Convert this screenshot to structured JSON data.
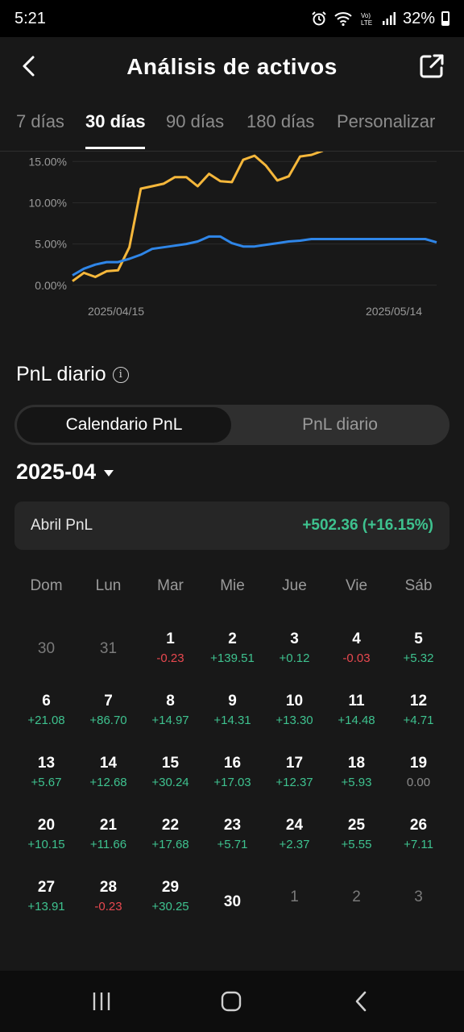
{
  "status_bar": {
    "time": "5:21",
    "battery": "32%"
  },
  "header": {
    "title": "Análisis de activos"
  },
  "tabs": [
    {
      "label": "7 días",
      "active": false
    },
    {
      "label": "30 días",
      "active": true
    },
    {
      "label": "90 días",
      "active": false
    },
    {
      "label": "180 días",
      "active": false
    },
    {
      "label": "Personalizar",
      "active": false
    }
  ],
  "chart_data": {
    "type": "line",
    "y_tick_labels": [
      "15.00%",
      "10.00%",
      "5.00%",
      "0.00%"
    ],
    "x_tick_labels": [
      "2025/04/15",
      "2025/05/14"
    ],
    "ylim": [
      -1,
      16.2
    ],
    "x_start": "2025/04/12",
    "x_end": "2025/05/14",
    "grid": true,
    "series": [
      {
        "color": "#f5b73b",
        "points": [
          [
            "2025/04/12",
            0.5
          ],
          [
            "2025/04/13",
            1.5
          ],
          [
            "2025/04/14",
            1.0
          ],
          [
            "2025/04/15",
            1.7
          ],
          [
            "2025/04/16",
            1.8
          ],
          [
            "2025/04/17",
            4.6
          ],
          [
            "2025/04/18",
            11.7
          ],
          [
            "2025/04/19",
            12.0
          ],
          [
            "2025/04/20",
            12.3
          ],
          [
            "2025/04/21",
            13.1
          ],
          [
            "2025/04/22",
            13.1
          ],
          [
            "2025/04/23",
            12.0
          ],
          [
            "2025/04/24",
            13.5
          ],
          [
            "2025/04/25",
            12.6
          ],
          [
            "2025/04/26",
            12.5
          ],
          [
            "2025/04/27",
            15.2
          ],
          [
            "2025/04/28",
            15.7
          ],
          [
            "2025/04/29",
            14.5
          ],
          [
            "2025/04/30",
            12.7
          ],
          [
            "2025/05/01",
            13.2
          ],
          [
            "2025/05/02",
            15.6
          ],
          [
            "2025/05/03",
            15.8
          ],
          [
            "2025/05/04",
            16.3
          ]
        ]
      },
      {
        "color": "#2f86e8",
        "points": [
          [
            "2025/04/12",
            1.2
          ],
          [
            "2025/04/13",
            2.0
          ],
          [
            "2025/04/14",
            2.5
          ],
          [
            "2025/04/15",
            2.8
          ],
          [
            "2025/04/16",
            2.8
          ],
          [
            "2025/04/17",
            3.2
          ],
          [
            "2025/04/18",
            3.7
          ],
          [
            "2025/04/19",
            4.4
          ],
          [
            "2025/04/20",
            4.6
          ],
          [
            "2025/04/21",
            4.8
          ],
          [
            "2025/04/22",
            5.0
          ],
          [
            "2025/04/23",
            5.3
          ],
          [
            "2025/04/24",
            5.9
          ],
          [
            "2025/04/25",
            5.9
          ],
          [
            "2025/04/26",
            5.1
          ],
          [
            "2025/04/27",
            4.7
          ],
          [
            "2025/04/28",
            4.7
          ],
          [
            "2025/04/29",
            4.9
          ],
          [
            "2025/04/30",
            5.1
          ],
          [
            "2025/05/01",
            5.3
          ],
          [
            "2025/05/02",
            5.4
          ],
          [
            "2025/05/03",
            5.6
          ],
          [
            "2025/05/04",
            5.6
          ],
          [
            "2025/05/05",
            5.6
          ],
          [
            "2025/05/06",
            5.6
          ],
          [
            "2025/05/07",
            5.6
          ],
          [
            "2025/05/08",
            5.6
          ],
          [
            "2025/05/09",
            5.6
          ],
          [
            "2025/05/10",
            5.6
          ],
          [
            "2025/05/11",
            5.6
          ],
          [
            "2025/05/12",
            5.6
          ],
          [
            "2025/05/13",
            5.6
          ],
          [
            "2025/05/14",
            5.2
          ]
        ]
      }
    ]
  },
  "pnl_section": {
    "title": "PnL diario",
    "toggle": {
      "calendar_label": "Calendario PnL",
      "daily_label": "PnL diario"
    },
    "month": "2025-04",
    "summary": {
      "label": "Abril PnL",
      "value": "+502.36 (+16.15%)"
    },
    "weekdays": [
      "Dom",
      "Lun",
      "Mar",
      "Mie",
      "Jue",
      "Vie",
      "Sáb"
    ],
    "weeks": [
      [
        {
          "day": "30",
          "muted": true
        },
        {
          "day": "31",
          "muted": true
        },
        {
          "day": "1",
          "pnl": "-0.23",
          "sign": "neg"
        },
        {
          "day": "2",
          "pnl": "+139.51",
          "sign": "pos"
        },
        {
          "day": "3",
          "pnl": "+0.12",
          "sign": "pos"
        },
        {
          "day": "4",
          "pnl": "-0.03",
          "sign": "neg"
        },
        {
          "day": "5",
          "pnl": "+5.32",
          "sign": "pos"
        }
      ],
      [
        {
          "day": "6",
          "pnl": "+21.08",
          "sign": "pos"
        },
        {
          "day": "7",
          "pnl": "+86.70",
          "sign": "pos"
        },
        {
          "day": "8",
          "pnl": "+14.97",
          "sign": "pos"
        },
        {
          "day": "9",
          "pnl": "+14.31",
          "sign": "pos"
        },
        {
          "day": "10",
          "pnl": "+13.30",
          "sign": "pos"
        },
        {
          "day": "11",
          "pnl": "+14.48",
          "sign": "pos"
        },
        {
          "day": "12",
          "pnl": "+4.71",
          "sign": "pos"
        }
      ],
      [
        {
          "day": "13",
          "pnl": "+5.67",
          "sign": "pos"
        },
        {
          "day": "14",
          "pnl": "+12.68",
          "sign": "pos"
        },
        {
          "day": "15",
          "pnl": "+30.24",
          "sign": "pos"
        },
        {
          "day": "16",
          "pnl": "+17.03",
          "sign": "pos"
        },
        {
          "day": "17",
          "pnl": "+12.37",
          "sign": "pos"
        },
        {
          "day": "18",
          "pnl": "+5.93",
          "sign": "pos"
        },
        {
          "day": "19",
          "pnl": "0.00",
          "sign": "zero"
        }
      ],
      [
        {
          "day": "20",
          "pnl": "+10.15",
          "sign": "pos"
        },
        {
          "day": "21",
          "pnl": "+11.66",
          "sign": "pos"
        },
        {
          "day": "22",
          "pnl": "+17.68",
          "sign": "pos"
        },
        {
          "day": "23",
          "pnl": "+5.71",
          "sign": "pos"
        },
        {
          "day": "24",
          "pnl": "+2.37",
          "sign": "pos"
        },
        {
          "day": "25",
          "pnl": "+5.55",
          "sign": "pos"
        },
        {
          "day": "26",
          "pnl": "+7.11",
          "sign": "pos"
        }
      ],
      [
        {
          "day": "27",
          "pnl": "+13.91",
          "sign": "pos"
        },
        {
          "day": "28",
          "pnl": "-0.23",
          "sign": "neg"
        },
        {
          "day": "29",
          "pnl": "+30.25",
          "sign": "pos"
        },
        {
          "day": "30",
          "nodata": true
        },
        {
          "day": "1",
          "muted": true
        },
        {
          "day": "2",
          "muted": true
        },
        {
          "day": "3",
          "muted": true
        }
      ]
    ]
  },
  "icons": {
    "back": "chevron-left-icon",
    "share": "external-link-icon",
    "info": "info-icon",
    "caret": "caret-down-icon",
    "nav_recent": "recent-apps-icon",
    "nav_home": "home-icon",
    "nav_back": "back-icon"
  }
}
